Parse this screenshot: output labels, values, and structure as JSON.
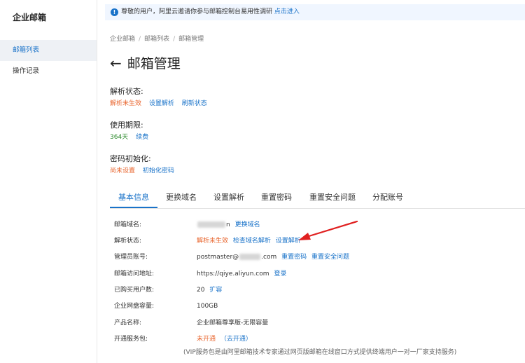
{
  "sidebar": {
    "title": "企业邮箱",
    "items": [
      {
        "label": "邮箱列表"
      },
      {
        "label": "操作记录"
      }
    ]
  },
  "notice": {
    "text": "尊敬的用户，阿里云邀请你参与邮箱控制台易用性调研",
    "link": "点击进入"
  },
  "breadcrumb": {
    "items": [
      "企业邮箱",
      "邮箱列表",
      "邮箱管理"
    ],
    "separator": "/"
  },
  "page": {
    "title": "邮箱管理"
  },
  "status_sections": {
    "dns": {
      "title": "解析状态:",
      "status": "解析未生效",
      "link1": "设置解析",
      "link2": "刷新状态"
    },
    "period": {
      "title": "使用期限:",
      "status": "364天",
      "link1": "续费"
    },
    "password": {
      "title": "密码初始化:",
      "status": "尚未设置",
      "link1": "初始化密码"
    }
  },
  "tabs": [
    {
      "label": "基本信息"
    },
    {
      "label": "更换域名"
    },
    {
      "label": "设置解析"
    },
    {
      "label": "重置密码"
    },
    {
      "label": "重置安全问题"
    },
    {
      "label": "分配账号"
    }
  ],
  "info": {
    "domain": {
      "label": "邮箱域名:",
      "suffix": "n",
      "link": "更换域名"
    },
    "dns": {
      "label": "解析状态:",
      "status": "解析未生效",
      "link1": "检查域名解析",
      "link2": "设置解析"
    },
    "admin": {
      "label": "管理员账号:",
      "prefix": "postmaster@",
      "suffix": ".com",
      "link1": "重置密码",
      "link2": "重置安全问题"
    },
    "url": {
      "label": "邮箱访问地址:",
      "value": "https://qiye.aliyun.com",
      "link": "登录"
    },
    "users": {
      "label": "已购买用户数:",
      "value": "20",
      "link": "扩容"
    },
    "disk": {
      "label": "企业网盘容量:",
      "value": "100GB"
    },
    "product": {
      "label": "产品名称:",
      "value": "企业邮箱尊享版-无限容量"
    },
    "vip": {
      "label": "开通服务包:",
      "status": "未开通",
      "link": "（去开通）"
    }
  },
  "footnote": "(VIP服务包是由阿里邮箱技术专家通过网页版邮箱在线窗口方式提供终端用户一对一厂家支持服务)",
  "colors": {
    "accent": "#1a73c9",
    "warning": "#e8642c",
    "success": "#2e8b2e",
    "annotation_arrow": "#e02020"
  }
}
